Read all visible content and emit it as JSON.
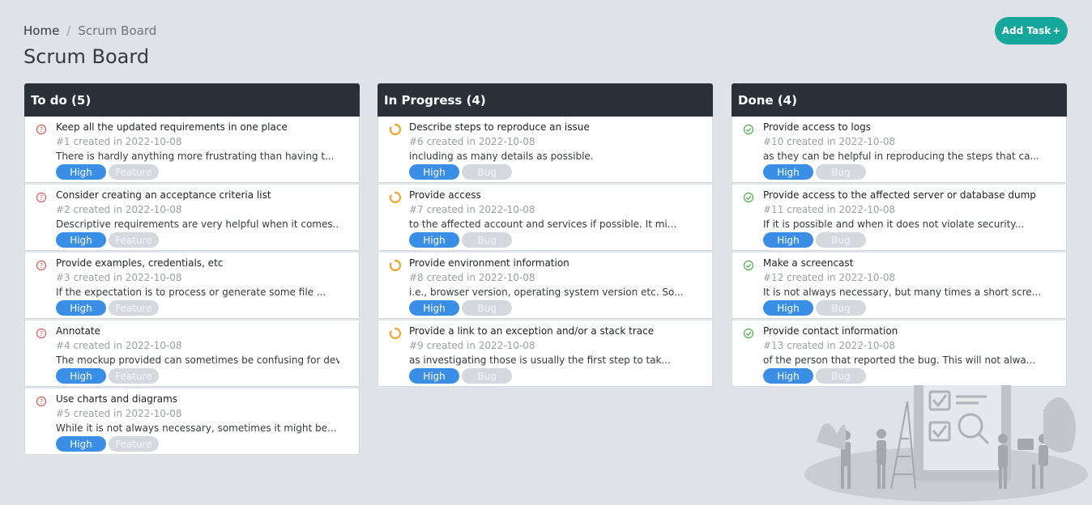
{
  "breadcrumb": {
    "home": "Home",
    "separator": "/",
    "current": "Scrum Board"
  },
  "page_title": "Scrum Board",
  "add_task": {
    "label": "Add Task",
    "icon": "+"
  },
  "colors": {
    "header_bg": "#2b3139",
    "accent": "#17a69b",
    "priority_tag": "#3a8ee6",
    "type_tag": "#d5d8dc",
    "todo_icon": "#e05a5a",
    "progress_icon": "#f0a52a",
    "done_icon": "#4caf50"
  },
  "columns": [
    {
      "title": "To do (5)",
      "status_icon": "question-circle-icon",
      "cards": [
        {
          "title": "Keep all the updated requirements in one place",
          "meta": "#1 created in 2022-10-08",
          "desc": "There is hardly anything more frustrating than having t...",
          "priority": "High",
          "type": "Feature"
        },
        {
          "title": "Consider creating an acceptance criteria list",
          "meta": "#2 created in 2022-10-08",
          "desc": "Descriptive requirements are very helpful when it comes...",
          "priority": "High",
          "type": "Feature"
        },
        {
          "title": "Provide examples, credentials, etc",
          "meta": "#3 created in 2022-10-08",
          "desc": "If the expectation is to process or generate some file ...",
          "priority": "High",
          "type": "Feature"
        },
        {
          "title": "Annotate",
          "meta": "#4 created in 2022-10-08",
          "desc": "The mockup provided can sometimes be confusing for deve...",
          "priority": "High",
          "type": "Feature"
        },
        {
          "title": "Use charts and diagrams",
          "meta": "#5 created in 2022-10-08",
          "desc": "While it is not always necessary, sometimes it might be...",
          "priority": "High",
          "type": "Feature"
        }
      ]
    },
    {
      "title": "In Progress (4)",
      "status_icon": "spinner-icon",
      "cards": [
        {
          "title": "Describe steps to reproduce an issue",
          "meta": "#6 created in 2022-10-08",
          "desc": "including as many details as possible.",
          "priority": "High",
          "type": "Bug"
        },
        {
          "title": "Provide access",
          "meta": "#7 created in 2022-10-08",
          "desc": "to the affected account and services if possible. It mi...",
          "priority": "High",
          "type": "Bug"
        },
        {
          "title": "Provide environment information",
          "meta": "#8 created in 2022-10-08",
          "desc": "i.e., browser version, operating system version etc. So...",
          "priority": "High",
          "type": "Bug"
        },
        {
          "title": "Provide a link to an exception and/or a stack trace",
          "meta": "#9 created in 2022-10-08",
          "desc": "as investigating those is usually the first step to tak...",
          "priority": "High",
          "type": "Bug"
        }
      ]
    },
    {
      "title": "Done (4)",
      "status_icon": "check-circle-icon",
      "cards": [
        {
          "title": "Provide access to logs",
          "meta": "#10 created in 2022-10-08",
          "desc": "as they can be helpful in reproducing the steps that ca...",
          "priority": "High",
          "type": "Bug"
        },
        {
          "title": "Provide access to the affected server or database dump",
          "meta": "#11 created in 2022-10-08",
          "desc": "If it is possible and when it does not violate security...",
          "priority": "High",
          "type": "Bug"
        },
        {
          "title": "Make a screencast",
          "meta": "#12 created in 2022-10-08",
          "desc": "It is not always necessary, but many times a short scre...",
          "priority": "High",
          "type": "Bug"
        },
        {
          "title": "Provide contact information",
          "meta": "#13 created in 2022-10-08",
          "desc": "of the person that reported the bug. This will not alwa...",
          "priority": "High",
          "type": "Bug"
        }
      ]
    }
  ]
}
